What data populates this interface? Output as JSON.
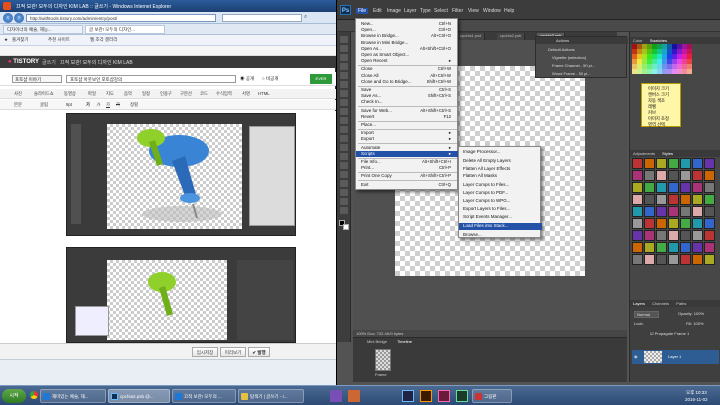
{
  "ie": {
    "title": "끄적 보관! 모두의 디자인 KIM LAB :: 글쓰기 - Windows Internet Explorer",
    "url": "http://withtools.tistory.com/admin/entry/post/",
    "tabs": [
      "디자이너의 예술, 재능...",
      "글 보관! 모두의 디자인..."
    ],
    "favorites": [
      "즐겨찾기",
      "추천 사이트",
      "웹 조각 갤러리"
    ],
    "tistory_logo": "TISTORY",
    "tistory_sub": "글쓰기",
    "blog_name": "끄적 보관! 모두의 디자인 KIM LAB",
    "category": "포토샵 이야기",
    "post_title": "포토샵 아웃보인 포토샵강의",
    "visibility": [
      "공개",
      "비공개"
    ],
    "editor_tools": [
      "사진",
      "슬라이드쇼",
      "동영상",
      "파일",
      "지도",
      "음악",
      "일정",
      "인용구",
      "구분선",
      "코드",
      "수식입력",
      "서명",
      "HTML"
    ],
    "editor_format": [
      "본문",
      "굴림",
      "9pt",
      "가",
      "가",
      "가",
      "가",
      "정렬"
    ],
    "bottom_buttons": {
      "save_temp": "임시저장",
      "preview": "미리보기",
      "publish": "발행"
    }
  },
  "ps": {
    "logo": "Ps",
    "menus": [
      "File",
      "Edit",
      "Image",
      "Layer",
      "Type",
      "Select",
      "Filter",
      "View",
      "Window",
      "Help"
    ],
    "doc_tabs": [
      "cpchia1.psd",
      "cpchia2.psb",
      "cpchia3.psb"
    ],
    "doc_status": "100%    Doc: 732.4K/0 bytes",
    "minibridge_tabs": [
      "Mini Bridge",
      "Timeline"
    ],
    "actions_title": "Actions",
    "actions": [
      "Default Actions",
      "Vignette (selection)",
      "Frame Channel - 50 pi...",
      "Wood Frame - 50 pi..."
    ],
    "swatches_tabs": [
      "Color",
      "Swatches"
    ],
    "notes": [
      "이미지 크기",
      "캔버스 크기",
      "자동 색조",
      "레벨",
      "커브",
      "이미지 조정",
      "영역 선택"
    ],
    "adjust_tabs": [
      "Adjustments",
      "Styles"
    ],
    "layers_tabs": [
      "Layers",
      "Channels",
      "Paths"
    ],
    "layer_mode": "Normal",
    "opacity_label": "Opacity: 100%",
    "fill_label": "Fill: 100%",
    "lock_label": "Lock:",
    "propagate": "Propagate Frame 1",
    "layer_name": "Layer 1",
    "mb_thumb": "Frame"
  },
  "file_menu": [
    {
      "label": "New...",
      "sc": "Ctrl+N"
    },
    {
      "label": "Open...",
      "sc": "Ctrl+O"
    },
    {
      "label": "Browse in Bridge...",
      "sc": "Alt+Ctrl+O"
    },
    {
      "label": "Browse in Mini Bridge...",
      "sc": ""
    },
    {
      "label": "Open As...",
      "sc": "Alt+Shift+Ctrl+O"
    },
    {
      "label": "Open as Smart Object...",
      "sc": ""
    },
    {
      "label": "Open Recent",
      "sc": "▸"
    },
    {
      "label": "Close",
      "sc": "Ctrl+W"
    },
    {
      "label": "Close All",
      "sc": "Alt+Ctrl+W"
    },
    {
      "label": "Close and Go to Bridge...",
      "sc": "Shift+Ctrl+W"
    },
    {
      "label": "Save",
      "sc": "Ctrl+S"
    },
    {
      "label": "Save As...",
      "sc": "Shift+Ctrl+S"
    },
    {
      "label": "Check In...",
      "sc": ""
    },
    {
      "label": "Save for Web...",
      "sc": "Alt+Shift+Ctrl+S"
    },
    {
      "label": "Revert",
      "sc": "F12"
    },
    {
      "label": "Place...",
      "sc": ""
    },
    {
      "label": "Import",
      "sc": "▸"
    },
    {
      "label": "Export",
      "sc": "▸"
    },
    {
      "label": "Automate",
      "sc": "▸"
    },
    {
      "label": "Scripts",
      "sc": "▸"
    },
    {
      "label": "File Info...",
      "sc": "Alt+Shift+Ctrl+I"
    },
    {
      "label": "Print...",
      "sc": "Ctrl+P"
    },
    {
      "label": "Print One Copy",
      "sc": "Alt+Shift+Ctrl+P"
    },
    {
      "label": "Exit",
      "sc": "Ctrl+Q"
    }
  ],
  "scripts_menu": [
    "Image Processor...",
    "Delete All Empty Layers",
    "Flatten All Layer Effects",
    "Flatten All Masks",
    "Layer Comps to Files...",
    "Layer Comps to PDF...",
    "Layer Comps to WPG...",
    "Export Layers to Files...",
    "Script Events Manager...",
    "Load Files into Stack...",
    "Browse..."
  ],
  "taskbar": {
    "start": "시작",
    "items": [
      "재미있는 예술, 재...",
      "cpchia2.psb @...",
      "끄적 보관! 모두의 ...",
      "탐색기 | 글쓰기 - I...",
      "그림판"
    ],
    "time": "오후 10:33",
    "date": "2016-11-02"
  },
  "colors": {
    "accent": "#2451a8",
    "ps_bg": "#535353",
    "notes_bg": "#fff6a8"
  }
}
